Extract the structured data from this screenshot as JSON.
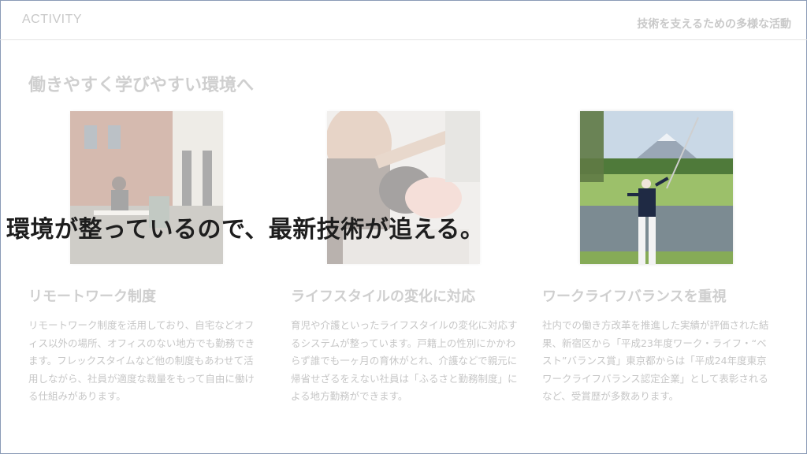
{
  "header": {
    "brand": "ACTIVITY",
    "title": "技術を支えるための多様な活動"
  },
  "section": {
    "title": "働きやすく学びやすい環境へ"
  },
  "cards": [
    {
      "title": "リモートワーク制度",
      "body": "リモートワーク制度を活用しており、自宅などオフィス以外の場所、オフィスのない地方でも勤務できます。フレックスタイムなど他の制度もあわせて活用しながら、社員が適度な裁量をもって自由に働ける仕組みがあります。"
    },
    {
      "title": "ライフスタイルの変化に対応",
      "body": "育児や介護といったライフスタイルの変化に対応するシステムが整っています。戸籍上の性別にかかわらず誰でも一ヶ月の育休がとれ、介護などで親元に帰省せざるをえない社員は「ふるさと勤務制度」による地方勤務ができます。"
    },
    {
      "title": "ワークライフバランスを重視",
      "body": "社内での働き方改革を推進した実績が評価された結果、新宿区から「平成23年度ワーク・ライフ・“ベスト”バランス賞」東京都からは「平成24年度東京ワークライフバランス認定企業」として表彰されるなど、受賞歴が多数あります。"
    }
  ],
  "overlay": {
    "caption": "環境が整っているので、最新技術が追える。"
  }
}
